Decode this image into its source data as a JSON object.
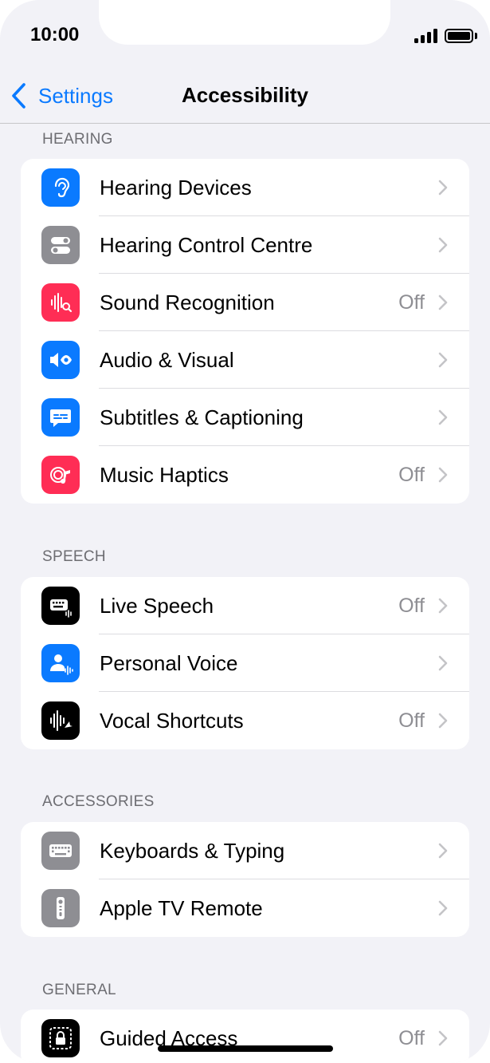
{
  "status_bar": {
    "time": "10:00"
  },
  "nav": {
    "back_label": "Settings",
    "title": "Accessibility"
  },
  "colors": {
    "accent": "#0a7aff",
    "blue_icon": "#0a7aff",
    "gray_icon": "#8e8e93",
    "red_icon": "#ff2d55",
    "black_icon": "#000000"
  },
  "sections": {
    "hearing": {
      "header": "HEARING",
      "items": [
        {
          "label": "Hearing Devices",
          "value": "",
          "icon": "ear-icon"
        },
        {
          "label": "Hearing Control Centre",
          "value": "",
          "icon": "toggles-icon"
        },
        {
          "label": "Sound Recognition",
          "value": "Off",
          "icon": "waveform-search-icon"
        },
        {
          "label": "Audio & Visual",
          "value": "",
          "icon": "speaker-eye-icon"
        },
        {
          "label": "Subtitles & Captioning",
          "value": "",
          "icon": "caption-bubble-icon"
        },
        {
          "label": "Music Haptics",
          "value": "Off",
          "icon": "music-haptics-icon"
        }
      ]
    },
    "speech": {
      "header": "SPEECH",
      "items": [
        {
          "label": "Live Speech",
          "value": "Off",
          "icon": "keyboard-wave-icon"
        },
        {
          "label": "Personal Voice",
          "value": "",
          "icon": "person-wave-icon"
        },
        {
          "label": "Vocal Shortcuts",
          "value": "Off",
          "icon": "waveform-arrow-icon"
        }
      ]
    },
    "accessories": {
      "header": "ACCESSORIES",
      "items": [
        {
          "label": "Keyboards & Typing",
          "value": "",
          "icon": "keyboard-icon"
        },
        {
          "label": "Apple TV Remote",
          "value": "",
          "icon": "remote-icon"
        }
      ]
    },
    "general": {
      "header": "GENERAL",
      "items": [
        {
          "label": "Guided Access",
          "value": "Off",
          "icon": "lock-dashed-icon"
        }
      ]
    }
  }
}
